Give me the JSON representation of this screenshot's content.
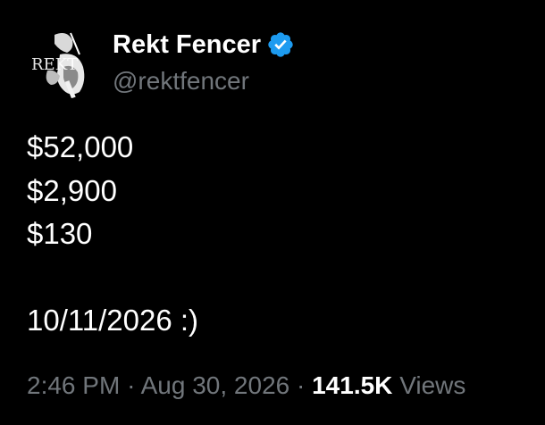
{
  "author": {
    "display_name": "Rekt Fencer",
    "handle": "@rektfencer",
    "verified": true,
    "avatar_text": "REKT",
    "verified_color": "#1d9bf0"
  },
  "tweet": {
    "lines": [
      "$52,000",
      "$2,900",
      "$130",
      "",
      "10/11/2026 :)"
    ]
  },
  "meta": {
    "time": "2:46 PM",
    "separator": "·",
    "date": "Aug 30, 2026",
    "views_count": "141.5K",
    "views_label": "Views"
  },
  "colors": {
    "background": "#000000",
    "text_primary": "#ffffff",
    "text_secondary": "#71767b"
  }
}
